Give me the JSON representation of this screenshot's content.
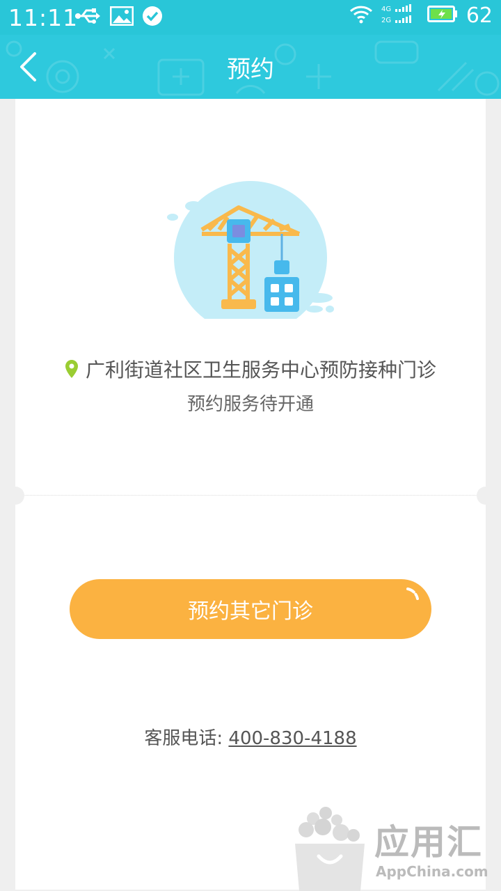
{
  "status_bar": {
    "time": "11:11",
    "network_top": "4G",
    "network_bottom": "2G",
    "battery": "62"
  },
  "header": {
    "title": "预约",
    "back_icon": "chevron-left-icon"
  },
  "clinic": {
    "name": "广利街道社区卫生服务中心预防接种门诊",
    "status": "预约服务待开通"
  },
  "actions": {
    "book_other_label": "预约其它门诊"
  },
  "support": {
    "hotline_label": "客服电话: ",
    "hotline_number": "400-830-4188"
  },
  "watermark": {
    "brand": "应用汇",
    "url": "AppChina.com"
  },
  "colors": {
    "primary": "#2ec9dd",
    "button": "#fbb241",
    "pin": "#9acd32"
  }
}
